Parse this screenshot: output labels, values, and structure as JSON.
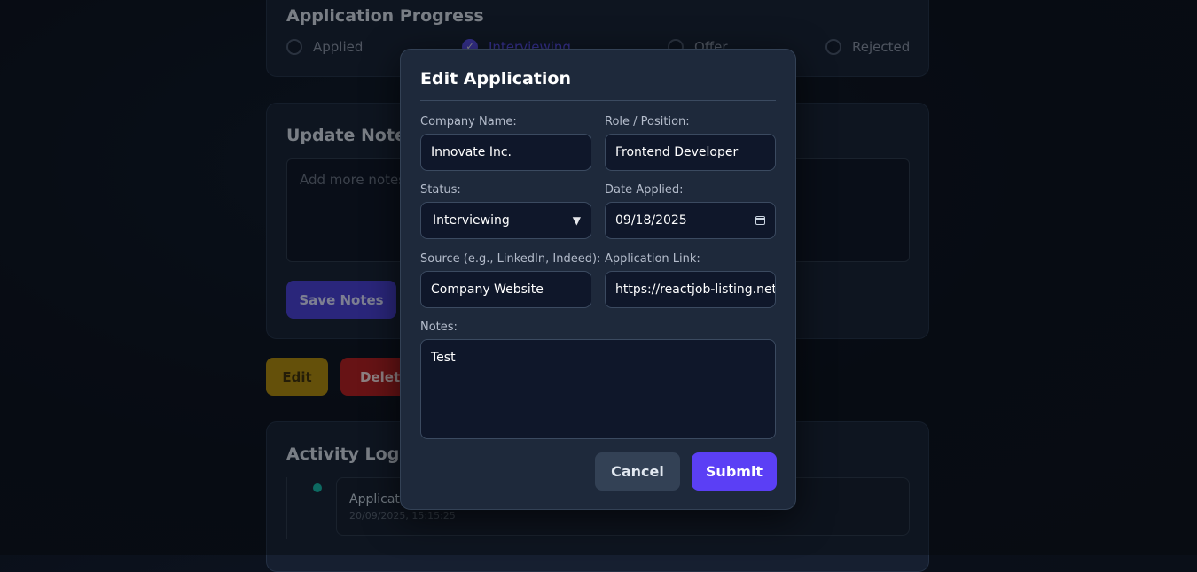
{
  "background": {
    "progress": {
      "title": "Application Progress",
      "steps": [
        "Applied",
        "Interviewing",
        "Offer",
        "Rejected"
      ],
      "active_step": "Interviewing"
    },
    "notes": {
      "title": "Update Notes",
      "placeholder": "Add more notes...",
      "save_label": "Save Notes"
    },
    "actions": {
      "edit_label": "Edit",
      "delete_label": "Delete"
    },
    "logs": {
      "title": "Activity Logs",
      "entries": [
        {
          "title": "Application updated",
          "time": "20/09/2025, 15:15:25"
        }
      ]
    }
  },
  "modal": {
    "title": "Edit Application",
    "company": {
      "label": "Company Name:",
      "value": "Innovate Inc."
    },
    "role": {
      "label": "Role / Position:",
      "value": "Frontend Developer"
    },
    "status": {
      "label": "Status:",
      "value": "Interviewing"
    },
    "date": {
      "label": "Date Applied:",
      "value": "09/18/2025"
    },
    "source": {
      "label": "Source (e.g., LinkedIn, Indeed):",
      "value": "Company Website"
    },
    "link": {
      "label": "Application Link:",
      "value": "https://reactjob-listing.netl"
    },
    "notes": {
      "label": "Notes:",
      "value": "Test"
    },
    "cancel_label": "Cancel",
    "submit_label": "Submit"
  },
  "colors": {
    "accent": "#5b3ff5",
    "edit": "#b28a08",
    "delete": "#b91c1c",
    "timeline_dot": "#14b8a6"
  }
}
